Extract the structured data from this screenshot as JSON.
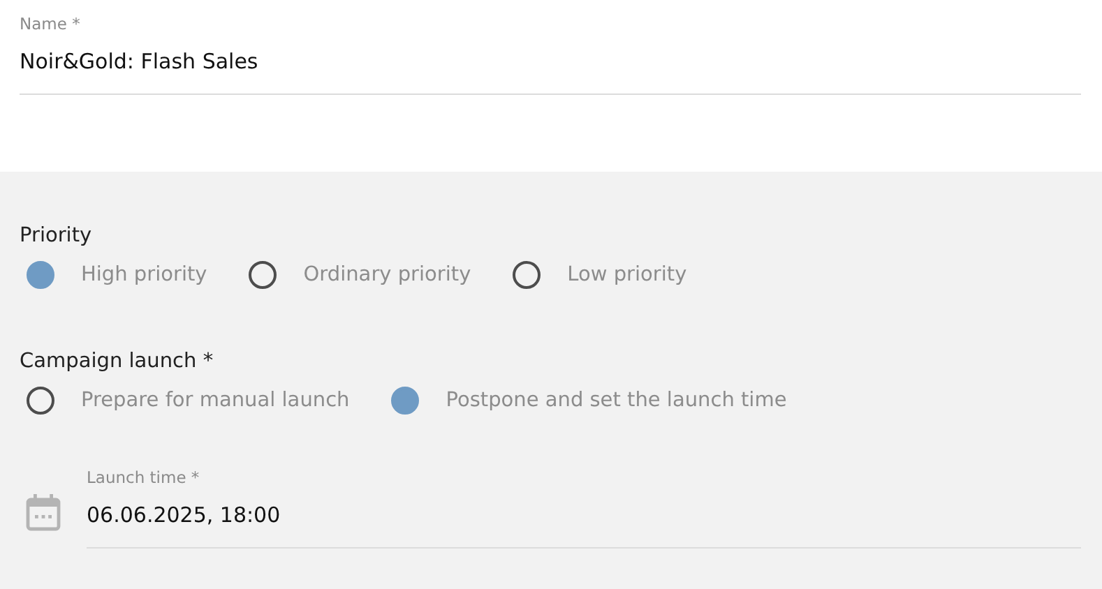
{
  "name_field": {
    "label": "Name *",
    "value": "Noir&Gold: Flash Sales"
  },
  "priority": {
    "label": "Priority",
    "options": [
      {
        "label": "High priority",
        "selected": true
      },
      {
        "label": "Ordinary priority",
        "selected": false
      },
      {
        "label": "Low priority",
        "selected": false
      }
    ]
  },
  "campaign_launch": {
    "label": "Campaign launch *",
    "options": [
      {
        "label": "Prepare for manual launch",
        "selected": false
      },
      {
        "label": "Postpone and set the launch time",
        "selected": true
      }
    ]
  },
  "launch_time": {
    "label": "Launch time *",
    "value": "06.06.2025, 18:00"
  }
}
